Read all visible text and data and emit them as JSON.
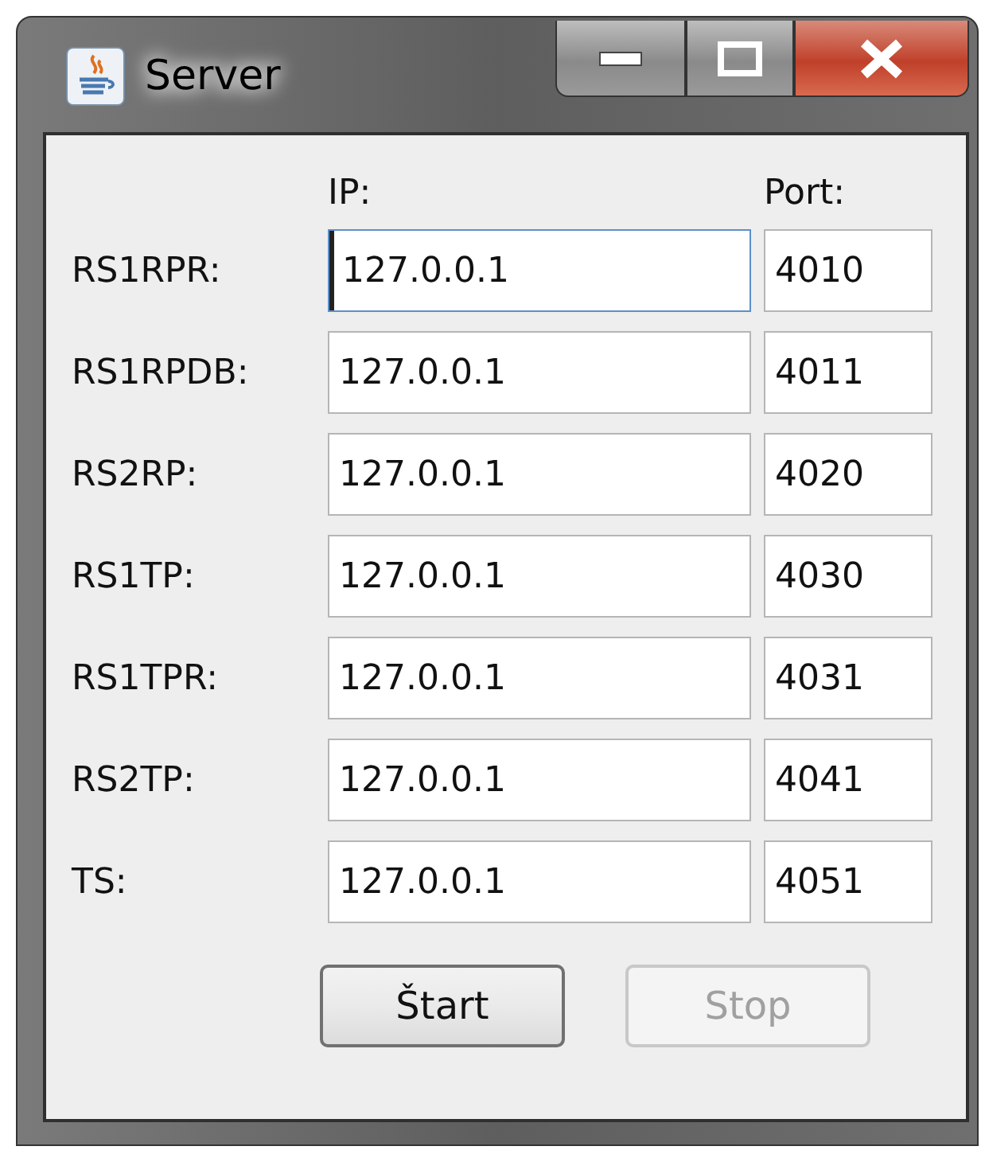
{
  "window": {
    "title": "Server"
  },
  "headers": {
    "ip": "IP:",
    "port": "Port:"
  },
  "rows": [
    {
      "label": "RS1RPR:",
      "ip": "127.0.0.1",
      "port": "4010",
      "focused": true
    },
    {
      "label": "RS1RPDB:",
      "ip": "127.0.0.1",
      "port": "4011",
      "focused": false
    },
    {
      "label": "RS2RP:",
      "ip": "127.0.0.1",
      "port": "4020",
      "focused": false
    },
    {
      "label": "RS1TP:",
      "ip": "127.0.0.1",
      "port": "4030",
      "focused": false
    },
    {
      "label": "RS1TPR:",
      "ip": "127.0.0.1",
      "port": "4031",
      "focused": false
    },
    {
      "label": "RS2TP:",
      "ip": "127.0.0.1",
      "port": "4041",
      "focused": false
    },
    {
      "label": "TS:",
      "ip": "127.0.0.1",
      "port": "4051",
      "focused": false
    }
  ],
  "buttons": [
    {
      "label": "Štart",
      "disabled": false
    },
    {
      "label": "Stop",
      "disabled": true
    }
  ]
}
